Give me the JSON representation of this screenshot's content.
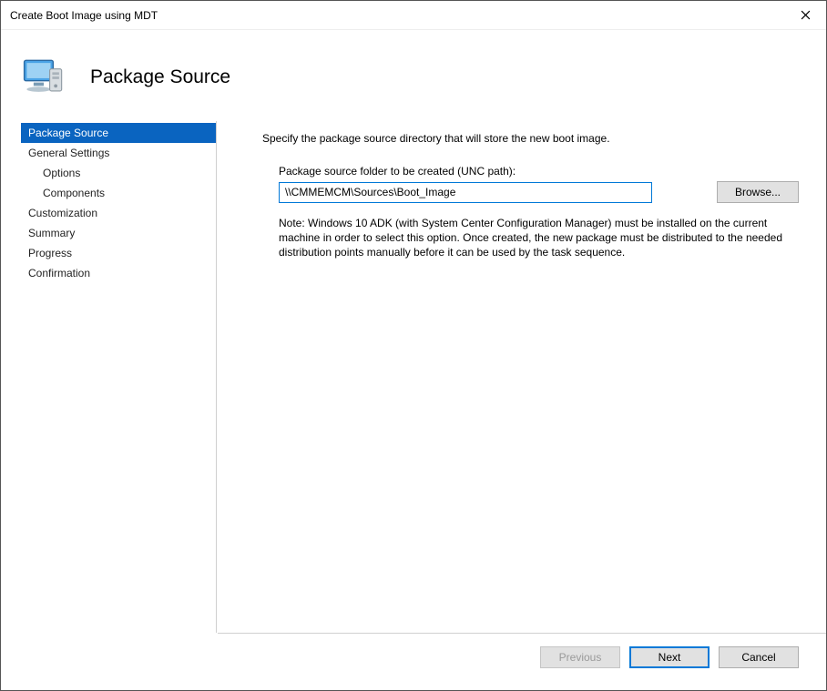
{
  "window": {
    "title": "Create Boot Image using MDT"
  },
  "header": {
    "page_title": "Package Source"
  },
  "sidebar": {
    "items": [
      {
        "label": "Package Source",
        "active": true
      },
      {
        "label": "General Settings"
      },
      {
        "label": "Options",
        "indent": true
      },
      {
        "label": "Components",
        "indent": true
      },
      {
        "label": "Customization"
      },
      {
        "label": "Summary"
      },
      {
        "label": "Progress"
      },
      {
        "label": "Confirmation"
      }
    ]
  },
  "content": {
    "instruction": "Specify the package source directory that will store the new boot image.",
    "field_label": "Package source folder to be created (UNC path):",
    "path_value": "\\\\CMMEMCM\\Sources\\Boot_Image",
    "browse_label": "Browse...",
    "note": "Note: Windows 10 ADK (with System Center Configuration Manager) must be installed on the current machine in order to select this option.  Once created, the new package must be distributed to the needed distribution points manually before it can be used by the task sequence."
  },
  "footer": {
    "previous": "Previous",
    "next": "Next",
    "cancel": "Cancel"
  }
}
